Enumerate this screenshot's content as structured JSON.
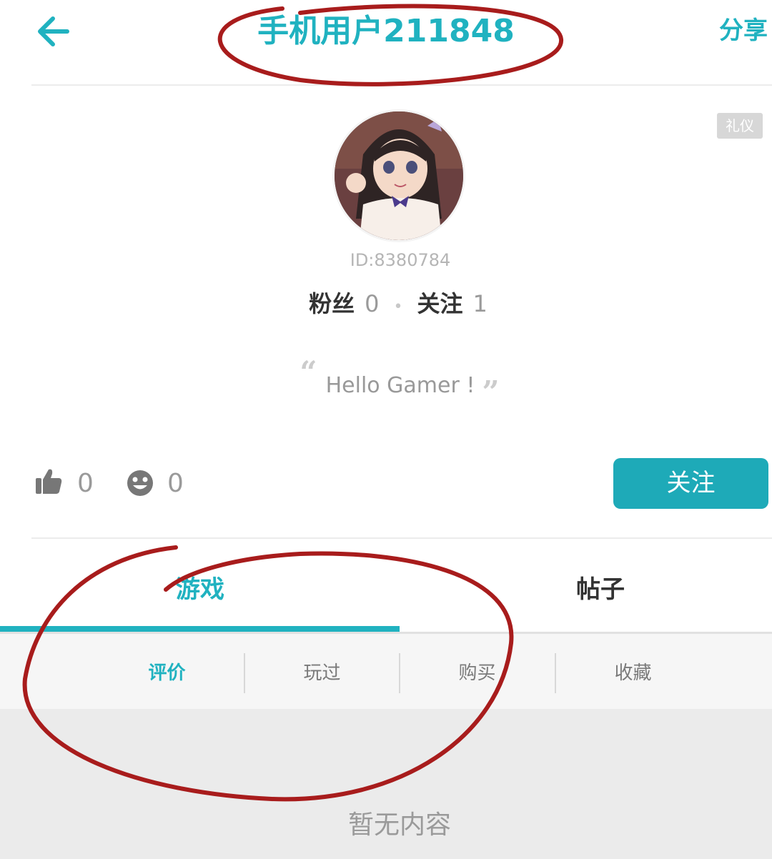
{
  "header": {
    "title": "手机用户211848",
    "share_label": "分享"
  },
  "profile": {
    "badge": "礼仪",
    "id_text": "ID:8380784",
    "fans_label": "粉丝",
    "fans_count": "0",
    "follow_label": "关注",
    "follow_count": "1",
    "quote_open": "“",
    "signature": "Hello Gamer !",
    "quote_close": "”"
  },
  "reactions": {
    "likes": "0",
    "smiles": "0"
  },
  "follow_button": "关注",
  "tabs": [
    {
      "label": "游戏"
    },
    {
      "label": "帖子"
    }
  ],
  "subtabs": [
    {
      "label": "评价"
    },
    {
      "label": "玩过"
    },
    {
      "label": "购买"
    },
    {
      "label": "收藏"
    }
  ],
  "empty_text": "暂无内容",
  "colors": {
    "accent": "#20b2c0",
    "button": "#1eaab8",
    "annotation": "#a81c1c"
  },
  "icons": {
    "back": "arrow-left-icon",
    "like": "thumbs-up-icon",
    "smile": "smiley-face-icon"
  }
}
